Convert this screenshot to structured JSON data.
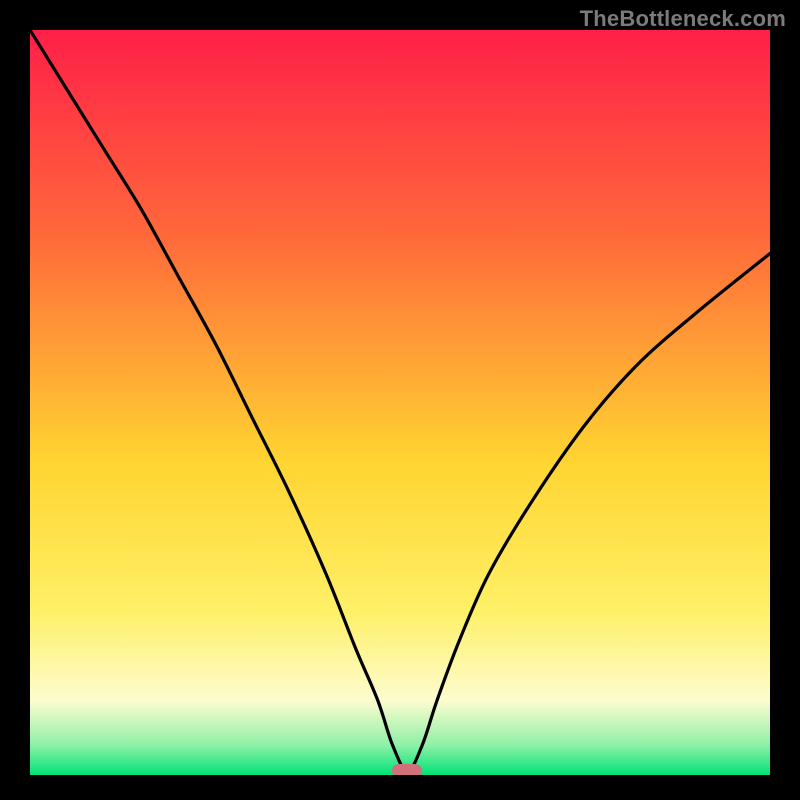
{
  "watermark": "TheBottleneck.com",
  "colors": {
    "top": "#ff1f48",
    "mid_upper": "#ff6a3a",
    "mid": "#ffd531",
    "mid_lower": "#fff067",
    "pale": "#fdfccf",
    "green_light": "#8ef0a6",
    "green": "#00e277",
    "marker": "#d07079",
    "curve": "#000000"
  },
  "chart_data": {
    "type": "line",
    "title": "",
    "xlabel": "",
    "ylabel": "",
    "x_range": [
      0,
      100
    ],
    "y_range": [
      0,
      100
    ],
    "minimum_at_x": 51,
    "marker": {
      "x": 51,
      "y": 0.5
    },
    "series": [
      {
        "name": "bottleneck-curve",
        "x": [
          0,
          5,
          10,
          15,
          20,
          25,
          30,
          35,
          40,
          44,
          47,
          49,
          51,
          53,
          55,
          58,
          62,
          68,
          75,
          82,
          90,
          100
        ],
        "y": [
          100,
          92,
          84,
          76,
          67,
          58,
          48,
          38,
          27,
          17,
          10,
          4,
          0.5,
          4,
          10,
          18,
          27,
          37,
          47,
          55,
          62,
          70
        ]
      }
    ],
    "gradient_stops": [
      {
        "offset": 0,
        "color": "#ff1f48"
      },
      {
        "offset": 28,
        "color": "#ff6a3a"
      },
      {
        "offset": 58,
        "color": "#ffd531"
      },
      {
        "offset": 78,
        "color": "#fff067"
      },
      {
        "offset": 90,
        "color": "#fdfccf"
      },
      {
        "offset": 96,
        "color": "#8ef0a6"
      },
      {
        "offset": 100,
        "color": "#00e277"
      }
    ]
  }
}
